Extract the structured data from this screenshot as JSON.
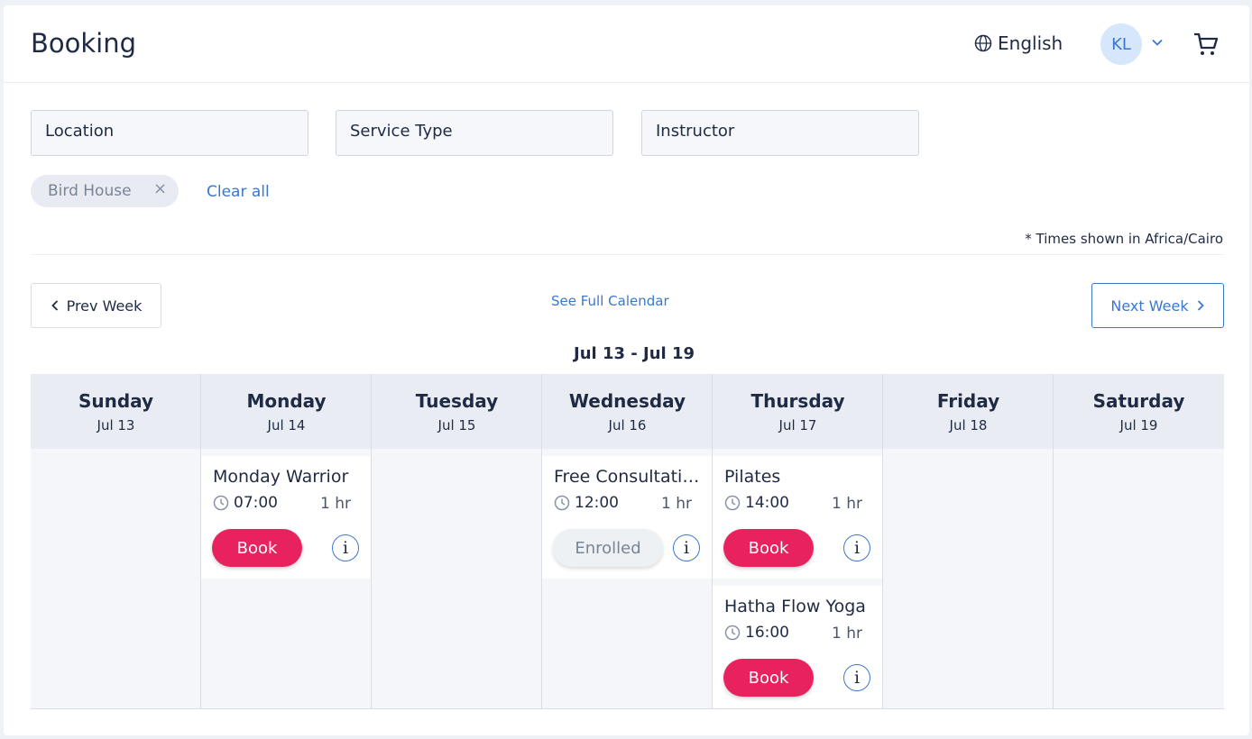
{
  "header": {
    "title": "Booking",
    "language": "English",
    "user_initials": "KL"
  },
  "filters": {
    "location": "Location",
    "service_type": "Service Type",
    "instructor": "Instructor",
    "chip": "Bird House",
    "chip_remove": "×",
    "clear_all": "Clear all",
    "timezone_note": "* Times shown in Africa/Cairo"
  },
  "nav": {
    "prev": "Prev Week",
    "next": "Next Week",
    "full_calendar": "See Full Calendar",
    "range": "Jul 13 - Jul 19"
  },
  "days": [
    {
      "name": "Sunday",
      "date": "Jul 13"
    },
    {
      "name": "Monday",
      "date": "Jul 14"
    },
    {
      "name": "Tuesday",
      "date": "Jul 15"
    },
    {
      "name": "Wednesday",
      "date": "Jul 16"
    },
    {
      "name": "Thursday",
      "date": "Jul 17"
    },
    {
      "name": "Friday",
      "date": "Jul 18"
    },
    {
      "name": "Saturday",
      "date": "Jul 19"
    }
  ],
  "events": [
    {
      "title": "Monday Warrior",
      "time": "07:00",
      "duration": "1 hr",
      "action": "Book"
    },
    {
      "title": "Free Consultation",
      "time": "12:00",
      "duration": "1 hr",
      "action": "Enrolled"
    },
    {
      "title": "Pilates",
      "time": "14:00",
      "duration": "1 hr",
      "action": "Book"
    },
    {
      "title": "Hatha Flow Yoga",
      "time": "16:00",
      "duration": "1 hr",
      "action": "Book"
    }
  ],
  "info_label": "i",
  "colors": {
    "accent": "#3a78d0",
    "book": "#e8215f",
    "header_bg": "#e9edf3",
    "column_bg": "#f4f6f9",
    "avatar_bg": "#d6e6fb"
  },
  "icons": {
    "language": "globe-icon",
    "user_menu": "chevron-down-icon",
    "cart": "cart-icon",
    "prev": "chevron-left-icon",
    "next": "chevron-right-icon",
    "time": "clock-icon",
    "info": "info-icon"
  }
}
